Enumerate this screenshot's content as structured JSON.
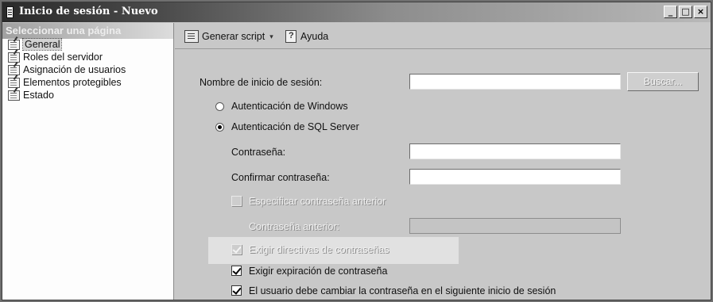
{
  "window": {
    "title": "Inicio de sesión - Nuevo",
    "controls": [
      "_",
      "□",
      "×"
    ]
  },
  "left_panel": {
    "header": "Seleccionar una página",
    "items": [
      {
        "label": "General",
        "selected": true,
        "icon": "page-properties-icon"
      },
      {
        "label": "Roles del servidor",
        "selected": false,
        "icon": "page-properties-icon"
      },
      {
        "label": "Asignación de usuarios",
        "selected": false,
        "icon": "page-properties-icon"
      },
      {
        "label": "Elementos protegibles",
        "selected": false,
        "icon": "page-properties-icon"
      },
      {
        "label": "Estado",
        "selected": false,
        "icon": "page-properties-icon"
      }
    ]
  },
  "toolbar": {
    "script_label": "Generar script",
    "script_caret": "▾",
    "help_label": "Ayuda"
  },
  "form": {
    "login_name_label": "Nombre de inicio de sesión:",
    "login_name_value": "",
    "search_button": "Buscar...",
    "auth_windows_label": "Autenticación de Windows",
    "auth_windows_selected": false,
    "auth_sql_label": "Autenticación de SQL Server",
    "auth_sql_selected": true,
    "password_label": "Contraseña:",
    "password_value": "",
    "confirm_password_label": "Confirmar contraseña:",
    "confirm_password_value": "",
    "specify_old_password_label": "Especificar contraseña anterior",
    "specify_old_password_checked": false,
    "old_password_label": "Contraseña anterior:",
    "old_password_value": "",
    "enforce_policy_label": "Exigir directivas de contraseñas",
    "enforce_policy_checked": true,
    "enforce_expiration_label": "Exigir expiración de contraseña",
    "enforce_expiration_checked": true,
    "must_change_label": "El usuario debe cambiar la contraseña en el siguiente inicio de sesión",
    "must_change_checked": true
  }
}
